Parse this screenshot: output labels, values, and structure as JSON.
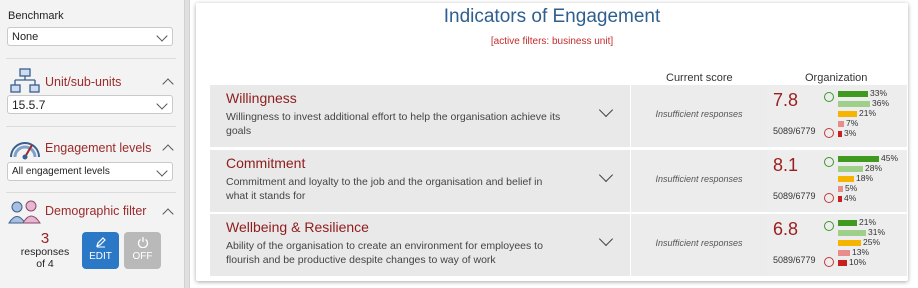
{
  "sidebar": {
    "benchmark_label": "Benchmark",
    "benchmark_value": "None",
    "unit_title": "Unit/sub-units",
    "unit_value": "15.5.7",
    "engagement_title": "Engagement levels",
    "engagement_value": "All engagement levels",
    "demographic_title": "Demographic filter",
    "responses_count": "3",
    "responses_label": "responses",
    "responses_of": "of 4",
    "edit_label": "EDIT",
    "off_label": "OFF"
  },
  "main": {
    "title": "Indicators of Engagement",
    "filters": "[active filters: business unit]",
    "col_current": "Current score",
    "col_org": "Organization"
  },
  "indicators": [
    {
      "name": "Willingness",
      "desc": "Willingness to invest additional effort to help the organisation achieve its goals",
      "current": "Insufficient responses",
      "score": "7.8",
      "responses": "5089/6779",
      "dist": [
        {
          "pct": "33%",
          "value": 33,
          "color": "#3f9a1f"
        },
        {
          "pct": "36%",
          "value": 36,
          "color": "#9fd08a"
        },
        {
          "pct": "21%",
          "value": 21,
          "color": "#f4b400"
        },
        {
          "pct": "7%",
          "value": 7,
          "color": "#e88c8c"
        },
        {
          "pct": "3%",
          "value": 3,
          "color": "#c82020"
        }
      ]
    },
    {
      "name": "Commitment",
      "desc": "Commitment and loyalty to the job and the organisation and belief in what it stands for",
      "current": "Insufficient responses",
      "score": "8.1",
      "responses": "5089/6779",
      "dist": [
        {
          "pct": "45%",
          "value": 45,
          "color": "#3f9a1f"
        },
        {
          "pct": "28%",
          "value": 28,
          "color": "#9fd08a"
        },
        {
          "pct": "18%",
          "value": 18,
          "color": "#f4b400"
        },
        {
          "pct": "5%",
          "value": 5,
          "color": "#e88c8c"
        },
        {
          "pct": "4%",
          "value": 4,
          "color": "#c82020"
        }
      ]
    },
    {
      "name": "Wellbeing & Resilience",
      "desc": "Ability of the organisation to create an environment for employees to flourish and be productive despite changes to way of work",
      "current": "Insufficient responses",
      "score": "6.8",
      "responses": "5089/6779",
      "dist": [
        {
          "pct": "21%",
          "value": 21,
          "color": "#3f9a1f"
        },
        {
          "pct": "31%",
          "value": 31,
          "color": "#9fd08a"
        },
        {
          "pct": "25%",
          "value": 25,
          "color": "#f4b400"
        },
        {
          "pct": "13%",
          "value": 13,
          "color": "#e88c8c"
        },
        {
          "pct": "10%",
          "value": 10,
          "color": "#c82020"
        }
      ]
    }
  ]
}
